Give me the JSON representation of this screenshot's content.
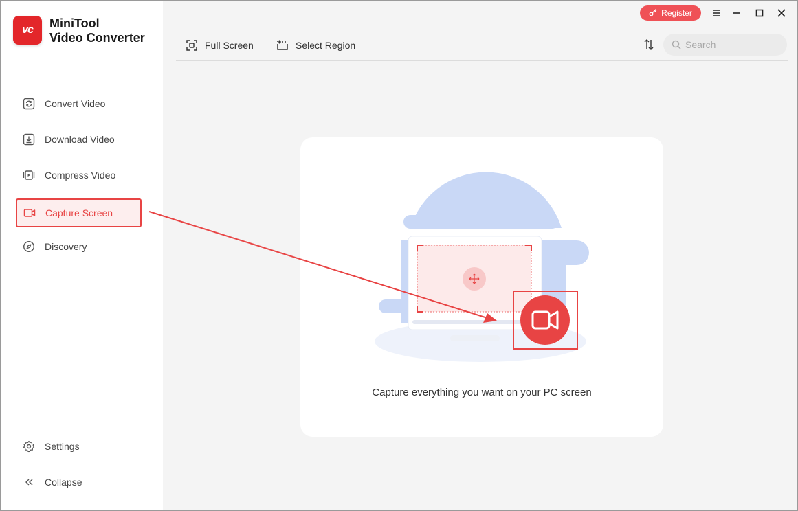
{
  "app": {
    "logo_text": "vc",
    "title_line1": "MiniTool",
    "title_line2": "Video Converter"
  },
  "header": {
    "register_label": "Register"
  },
  "sidebar": {
    "items": [
      {
        "label": "Convert Video",
        "icon": "convert-icon"
      },
      {
        "label": "Download Video",
        "icon": "download-icon"
      },
      {
        "label": "Compress Video",
        "icon": "compress-icon"
      },
      {
        "label": "Capture Screen",
        "icon": "capture-icon",
        "active": true
      },
      {
        "label": "Discovery",
        "icon": "compass-icon"
      }
    ],
    "settings_label": "Settings",
    "collapse_label": "Collapse"
  },
  "toolbar": {
    "full_screen_label": "Full Screen",
    "select_region_label": "Select Region"
  },
  "search": {
    "placeholder": "Search"
  },
  "main": {
    "caption": "Capture everything you want on your PC screen"
  },
  "colors": {
    "accent": "#e84444",
    "register": "#ef5156",
    "illustration_blue": "#c9d8f6"
  }
}
